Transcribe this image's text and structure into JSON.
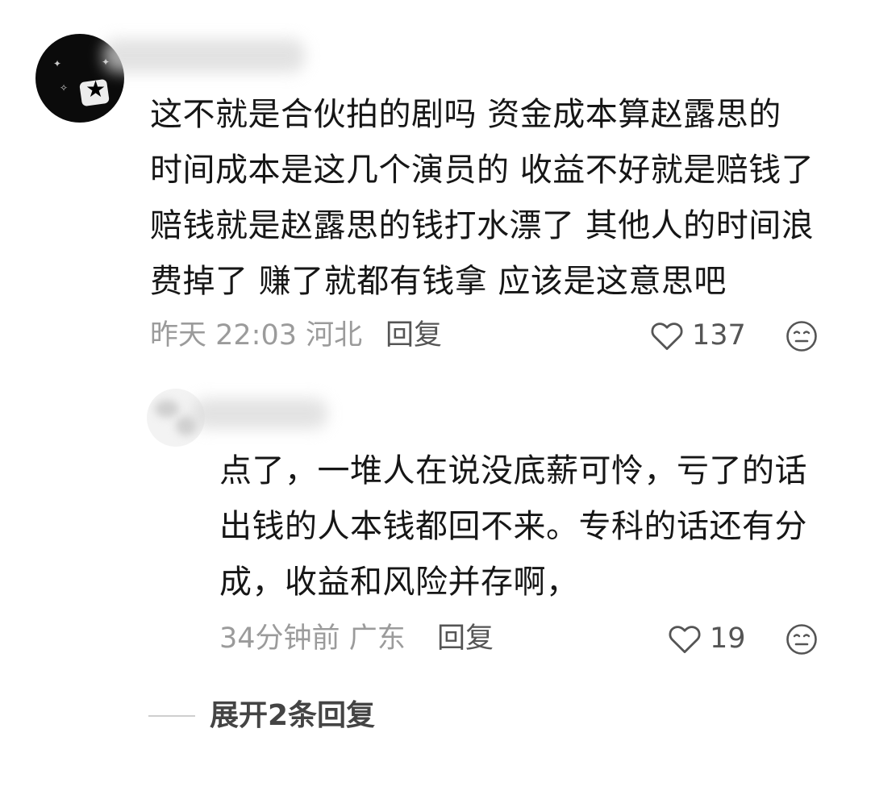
{
  "comment": {
    "lines": [
      "这不就是合伙拍的剧吗 资金成本算赵露思的",
      "时间成本是这几个演员的 收益不好就是赔钱了",
      "赔钱就是赵露思的钱打水漂了 其他人的时间浪",
      "费掉了 赚了就都有钱拿 应该是这意思吧"
    ],
    "time": "昨天 22:03",
    "location": "河北",
    "reply_label": "回复",
    "likes": "137",
    "like_icon": "heart-outline",
    "emoji_icon": "face-emoji"
  },
  "reply": {
    "lines": [
      "点了，一堆人在说没底薪可怜，亏了的话",
      "出钱的人本钱都回不来。专科的话还有分",
      "成，收益和风险并存啊，"
    ],
    "time": "34分钟前",
    "location": "广东",
    "reply_label": "回复",
    "likes": "19",
    "like_icon": "heart-outline",
    "emoji_icon": "face-emoji"
  },
  "expand": {
    "label": "展开2条回复"
  },
  "colors": {
    "text": "#161616",
    "meta": "#9b9b9b",
    "action": "#555555"
  }
}
